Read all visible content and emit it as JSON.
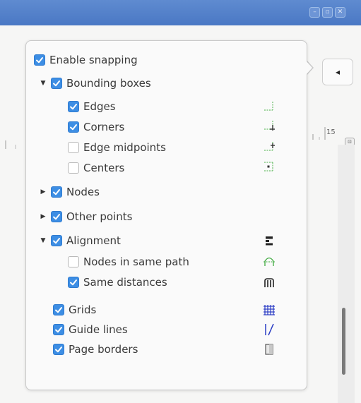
{
  "window": {
    "buttons": [
      {
        "glyph": "–"
      },
      {
        "glyph": "▫"
      },
      {
        "glyph": "✕"
      }
    ]
  },
  "canvas": {
    "collapse_glyph": "◂",
    "ruler_number": "15",
    "zoom_corner_glyph": "⊡"
  },
  "snapping": {
    "enable": {
      "label": "Enable snapping",
      "checked": true
    },
    "bounding_boxes": {
      "label": "Bounding boxes",
      "checked": true,
      "expanded": true,
      "children": [
        {
          "label": "Edges",
          "checked": true,
          "icon": "bbox-edge-icon"
        },
        {
          "label": "Corners",
          "checked": true,
          "icon": "bbox-corner-icon"
        },
        {
          "label": "Edge midpoints",
          "checked": false,
          "icon": "bbox-edge-midpoint-icon"
        },
        {
          "label": "Centers",
          "checked": false,
          "icon": "bbox-center-icon"
        }
      ]
    },
    "nodes": {
      "label": "Nodes",
      "checked": true,
      "expanded": false
    },
    "other_points": {
      "label": "Other points",
      "checked": true,
      "expanded": false
    },
    "alignment": {
      "label": "Alignment",
      "checked": true,
      "expanded": true,
      "icon": "alignment-icon",
      "children": [
        {
          "label": "Nodes in same path",
          "checked": false,
          "icon": "path-nodes-icon"
        },
        {
          "label": "Same distances",
          "checked": true,
          "icon": "distances-icon"
        }
      ]
    },
    "grids": {
      "label": "Grids",
      "checked": true,
      "icon": "grid-icon"
    },
    "guide_lines": {
      "label": "Guide lines",
      "checked": true,
      "icon": "guide-icon"
    },
    "page_borders": {
      "label": "Page borders",
      "checked": true,
      "icon": "page-icon"
    }
  },
  "colors": {
    "accent": "#3d8ee4",
    "icon_green": "#6abf69",
    "icon_blue": "#2a3cc4",
    "titlebar": "#5584cc"
  }
}
